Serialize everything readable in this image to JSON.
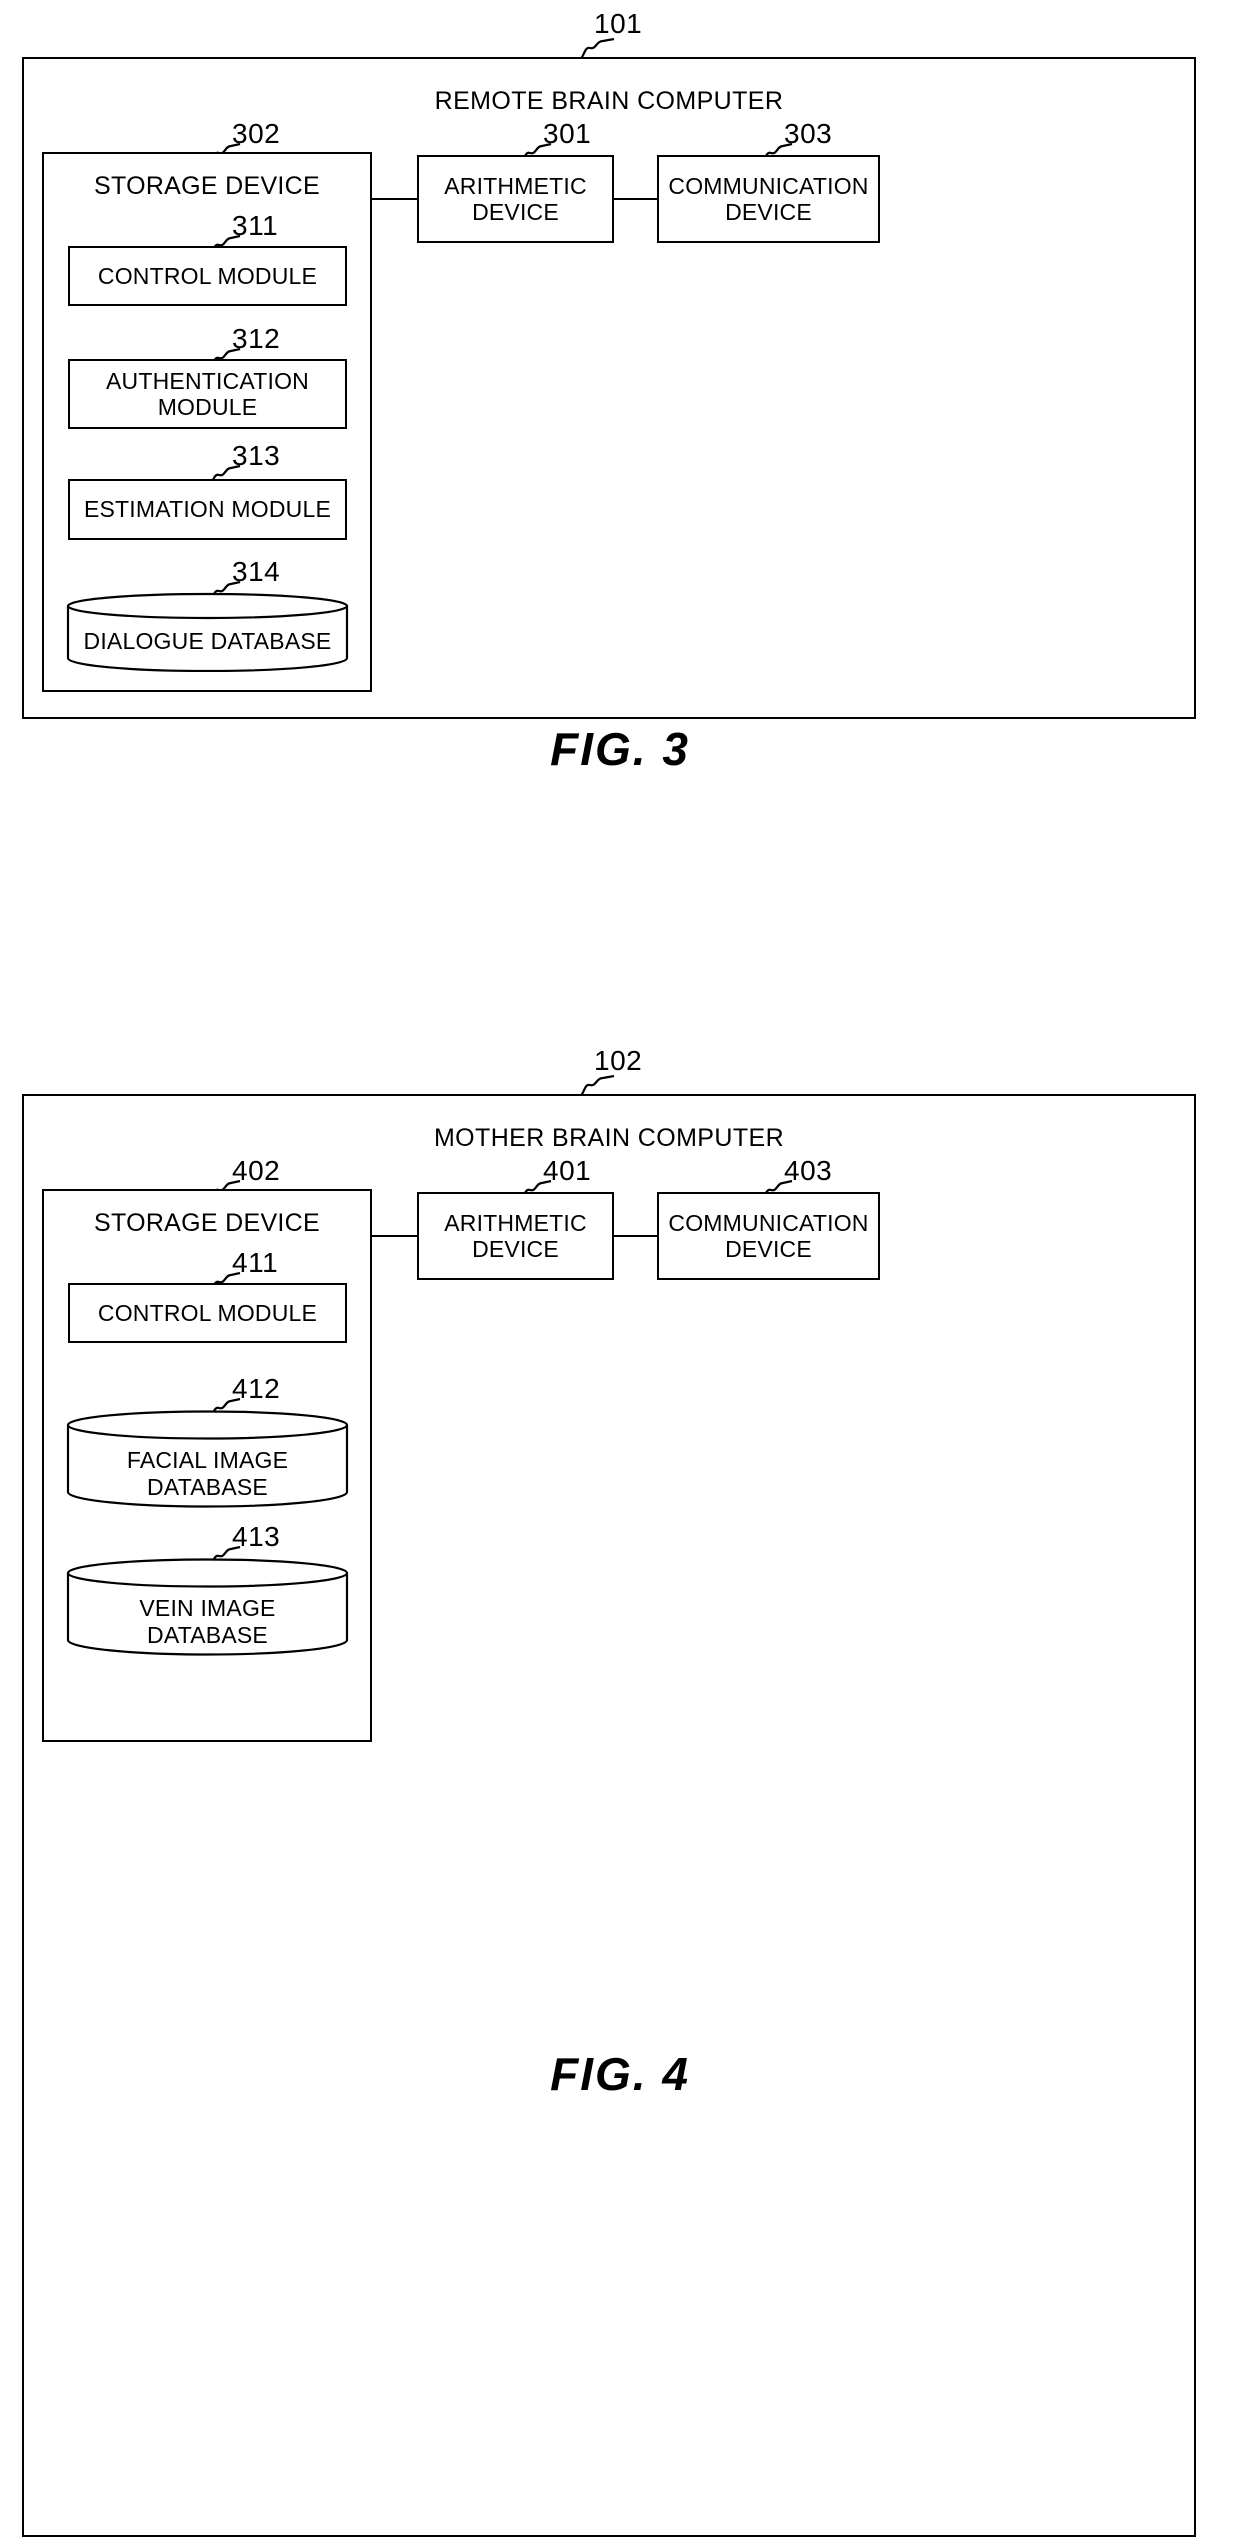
{
  "figures": [
    {
      "caption": "FIG. 3",
      "system_ref": "101",
      "system_title": "REMOTE BRAIN COMPUTER",
      "arithmetic": {
        "ref": "301",
        "line1": "ARITHMETIC",
        "line2": "DEVICE"
      },
      "communication": {
        "ref": "303",
        "line1": "COMMUNICATION",
        "line2": "DEVICE"
      },
      "storage": {
        "ref": "302",
        "label": "STORAGE DEVICE"
      },
      "modules": [
        {
          "ref": "311",
          "shape": "rect",
          "line1": "CONTROL MODULE",
          "line2": ""
        },
        {
          "ref": "312",
          "shape": "rect",
          "line1": "AUTHENTICATION",
          "line2": "MODULE"
        },
        {
          "ref": "313",
          "shape": "rect",
          "line1": "ESTIMATION MODULE",
          "line2": ""
        },
        {
          "ref": "314",
          "shape": "cylinder",
          "line1": "DIALOGUE DATABASE",
          "line2": ""
        }
      ]
    },
    {
      "caption": "FIG. 4",
      "system_ref": "102",
      "system_title": "MOTHER BRAIN COMPUTER",
      "arithmetic": {
        "ref": "401",
        "line1": "ARITHMETIC",
        "line2": "DEVICE"
      },
      "communication": {
        "ref": "403",
        "line1": "COMMUNICATION",
        "line2": "DEVICE"
      },
      "storage": {
        "ref": "402",
        "label": "STORAGE DEVICE"
      },
      "modules": [
        {
          "ref": "411",
          "shape": "rect",
          "line1": "CONTROL MODULE",
          "line2": ""
        },
        {
          "ref": "412",
          "shape": "cylinder",
          "line1": "FACIAL IMAGE",
          "line2": "DATABASE"
        },
        {
          "ref": "413",
          "shape": "cylinder",
          "line1": "VEIN IMAGE",
          "line2": "DATABASE"
        }
      ]
    }
  ]
}
